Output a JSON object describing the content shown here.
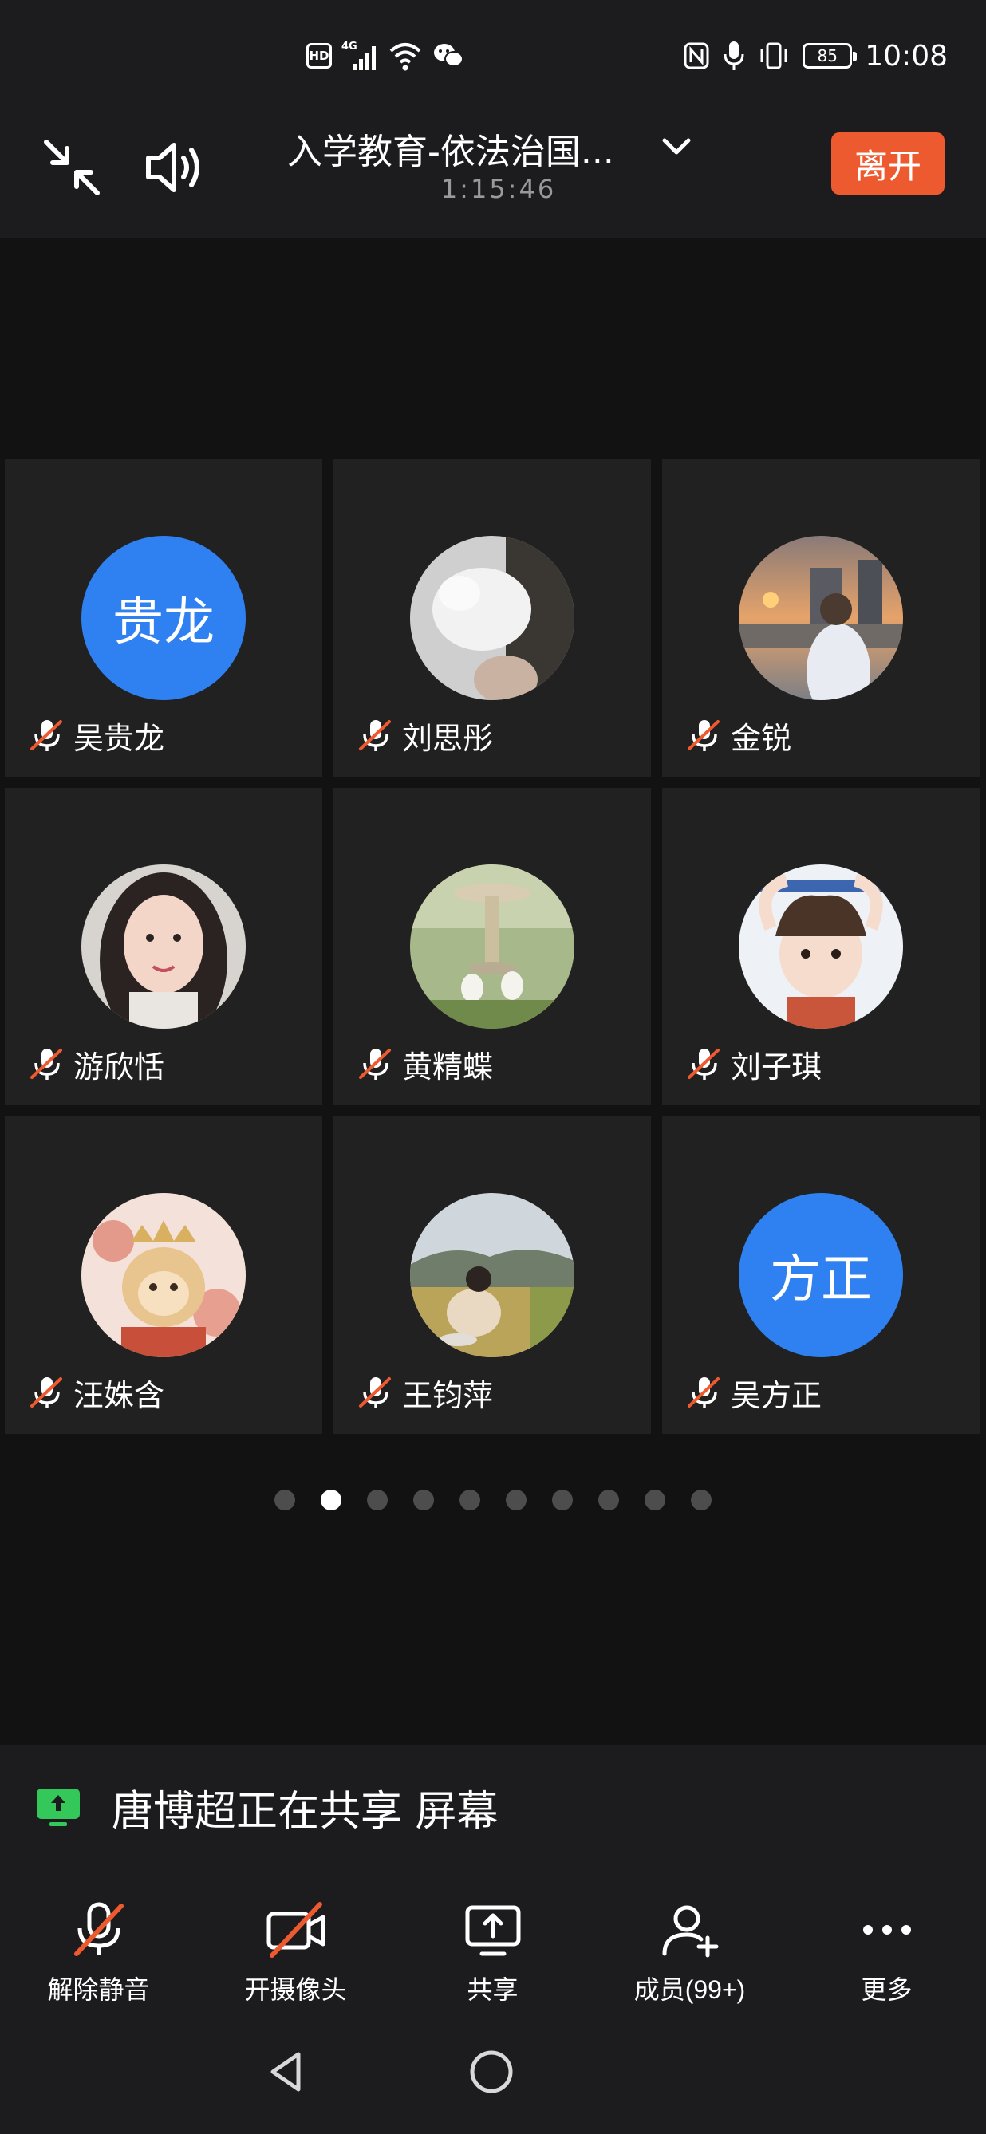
{
  "status_bar": {
    "hd_label": "HD",
    "network_label": "4G",
    "battery": "85",
    "time": "10:08"
  },
  "meeting": {
    "title": "入学教育-依法治国...",
    "timer": "1:15:46",
    "leave_label": "离开"
  },
  "participants": [
    {
      "name": "吴贵龙",
      "avatar_type": "initials",
      "initials": "贵龙",
      "muted": true
    },
    {
      "name": "刘思彤",
      "avatar_type": "photo",
      "muted": true
    },
    {
      "name": "金锐",
      "avatar_type": "photo",
      "muted": true
    },
    {
      "name": "游欣恬",
      "avatar_type": "photo",
      "muted": true
    },
    {
      "name": "黄精蝶",
      "avatar_type": "photo",
      "muted": true
    },
    {
      "name": "刘子琪",
      "avatar_type": "photo",
      "muted": true
    },
    {
      "name": "汪姝含",
      "avatar_type": "photo",
      "muted": true
    },
    {
      "name": "王钧萍",
      "avatar_type": "photo",
      "muted": true
    },
    {
      "name": "吴方正",
      "avatar_type": "initials",
      "initials": "方正",
      "muted": true
    }
  ],
  "pagination": {
    "total_pages": 10,
    "current_page": 2
  },
  "share_banner": {
    "text": "唐博超正在共享 屏幕"
  },
  "toolbar": {
    "unmute_label": "解除静音",
    "camera_label": "开摄像头",
    "share_label": "共享",
    "members_label": "成员(99+)",
    "more_label": "更多"
  },
  "colors": {
    "accent_blue": "#2f80f0",
    "leave_orange": "#ee5a2f",
    "mute_red": "#ee5a2f",
    "share_green": "#34c759",
    "background": "#121212"
  }
}
